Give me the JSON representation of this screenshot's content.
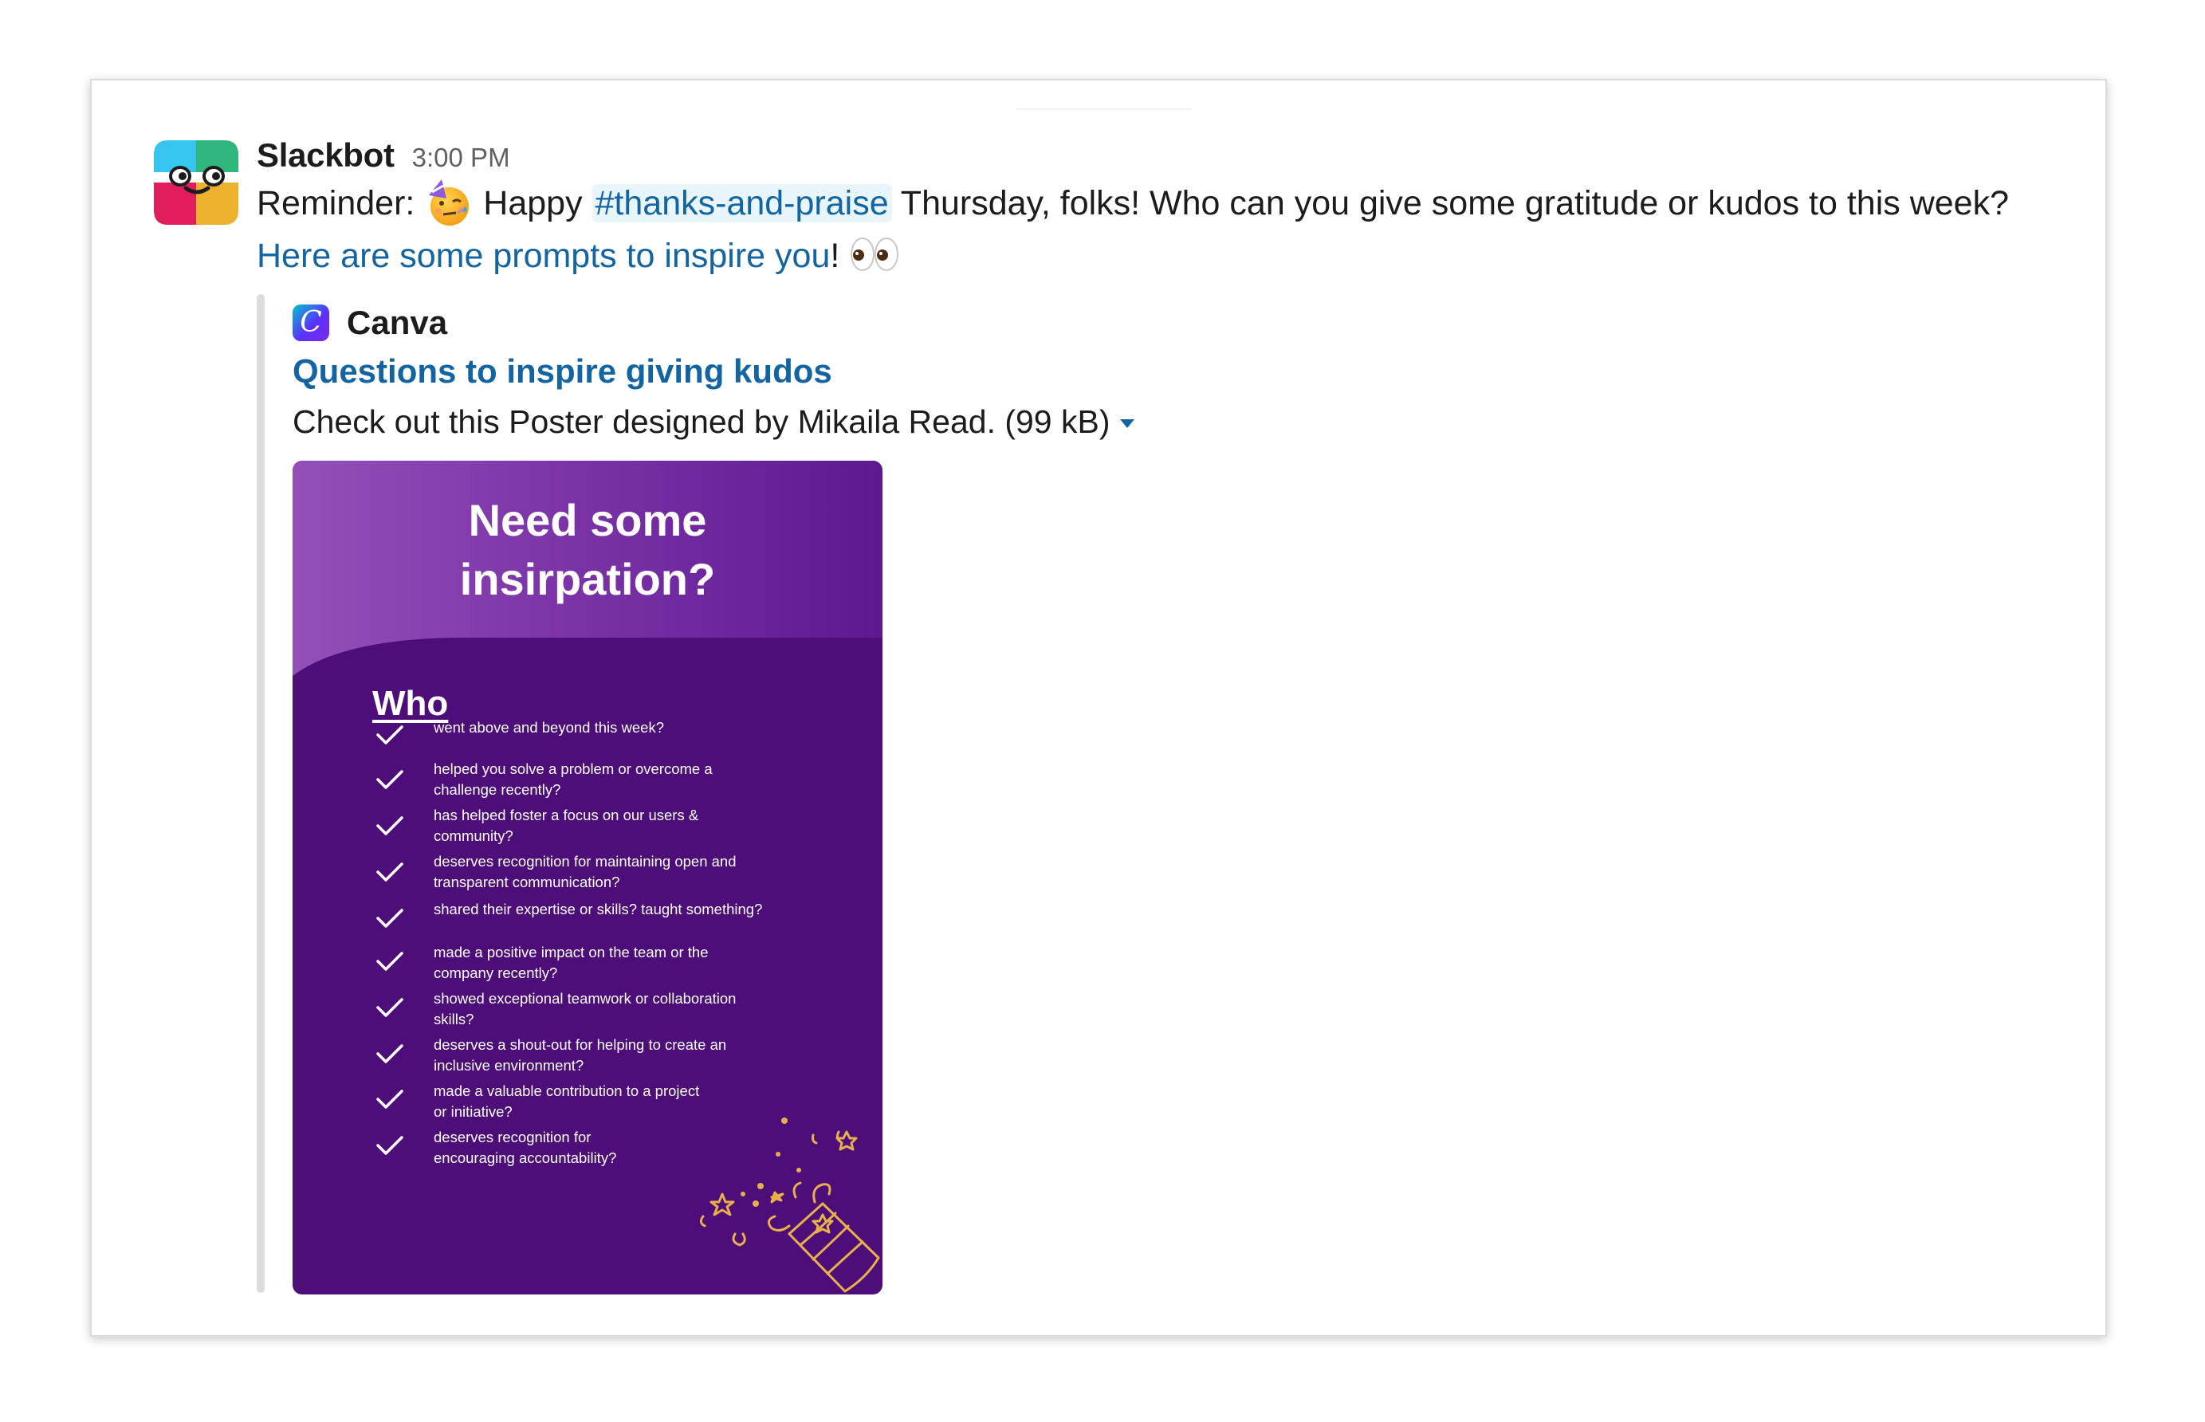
{
  "message": {
    "author": "Slackbot",
    "time": "3:00 PM",
    "text_prefix": "Reminder:",
    "text_happy": "Happy",
    "channel": "#thanks-and-praise",
    "text_suffix": "Thursday, folks! Who can you give some gratitude or kudos to this week?",
    "link_text": "Here are some prompts to inspire you",
    "link_trailing": "!",
    "emoji_partying": "partying-face-emoji",
    "emoji_eyes": "eyes-emoji"
  },
  "attachment": {
    "service_name": "Canva",
    "service_logo_letter": "C",
    "title": "Questions to inspire giving kudos",
    "description": "Check out this Poster designed by Mikaila Read. (99 kB)",
    "poster": {
      "heading_line1": "Need some",
      "heading_line2": "insirpation?",
      "section_title": "Who",
      "items": [
        {
          "line1": "went above and beyond this week?",
          "line2": ""
        },
        {
          "line1": "helped you solve a problem or overcome a",
          "line2": "challenge recently?"
        },
        {
          "line1": "has helped foster a focus on our users &",
          "line2": "community?"
        },
        {
          "line1": "deserves recognition for maintaining open and",
          "line2": "transparent communication?"
        },
        {
          "line1": "shared their expertise or skills? taught something?",
          "line2": ""
        },
        {
          "line1": "made a positive impact on the team or the",
          "line2": "company recently?"
        },
        {
          "line1": "showed exceptional teamwork or collaboration",
          "line2": "skills?"
        },
        {
          "line1": "deserves a shout-out for helping to create an",
          "line2": "inclusive environment?"
        },
        {
          "line1": "made a valuable contribution to a project",
          "line2": "or initiative?"
        },
        {
          "line1": "deserves recognition for",
          "line2": "encouraging accountability?"
        }
      ]
    }
  },
  "colors": {
    "link": "#1264a3",
    "channel_bg": "#e8f5fa",
    "poster_purple": "#4d0e7a",
    "poster_accent": "#e8b04a"
  }
}
